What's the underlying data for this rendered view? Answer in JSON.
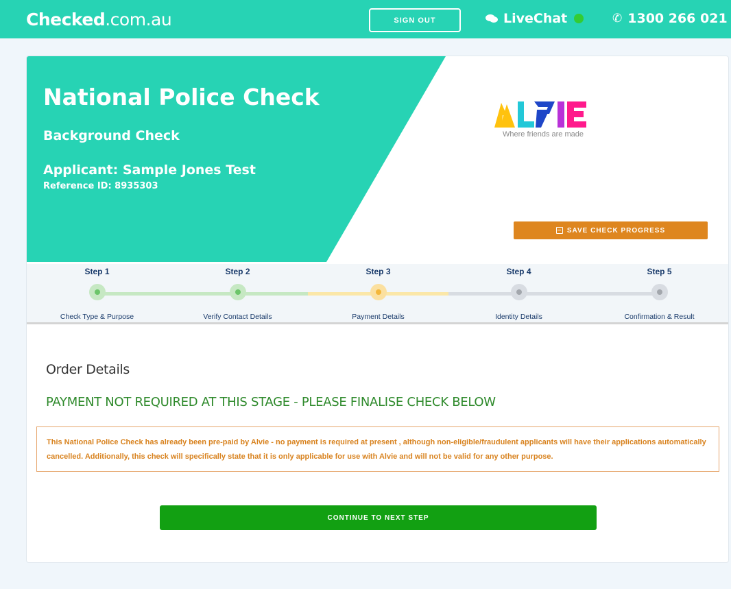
{
  "header": {
    "logo_bold": "Checked",
    "logo_light": ".com.au",
    "signout_label": "SIGN OUT",
    "livechat_label": "LiveChat",
    "phone": "1300 266 021"
  },
  "hero": {
    "title": "National Police Check",
    "subtitle": "Background Check",
    "applicant": "Applicant: Sample Jones Test",
    "reference": "Reference ID: 8935303",
    "partner_logo_text": "ALVIE",
    "partner_tagline": "Where friends are made",
    "save_label": "SAVE CHECK PROGRESS"
  },
  "steps": [
    {
      "title": "Step 1",
      "label": "Check Type & Purpose",
      "state": "done"
    },
    {
      "title": "Step 2",
      "label": "Verify Contact Details",
      "state": "done"
    },
    {
      "title": "Step 3",
      "label": "Payment Details",
      "state": "current"
    },
    {
      "title": "Step 4",
      "label": "Identity Details",
      "state": "pending"
    },
    {
      "title": "Step 5",
      "label": "Confirmation & Result",
      "state": "pending"
    }
  ],
  "order": {
    "title": "Order Details",
    "payment_note": "PAYMENT NOT REQUIRED AT THIS STAGE - PLEASE FINALISE CHECK BELOW",
    "alert": "This National Police Check has already been pre-paid by Alvie - no payment is required at present , although non-eligible/fraudulent applicants will have their applications automatically cancelled. Additionally, this check will specifically state that it is only applicable for use with Alvie and will not be valid for any other purpose.",
    "continue_label": "CONTINUE TO NEXT STEP"
  },
  "colors": {
    "brand": "#27d3b4",
    "done_track": "#c6e8c3",
    "current_track": "#fbe7a8",
    "pending_track": "#d8dce2",
    "save": "#de861f",
    "continue": "#12a012"
  }
}
